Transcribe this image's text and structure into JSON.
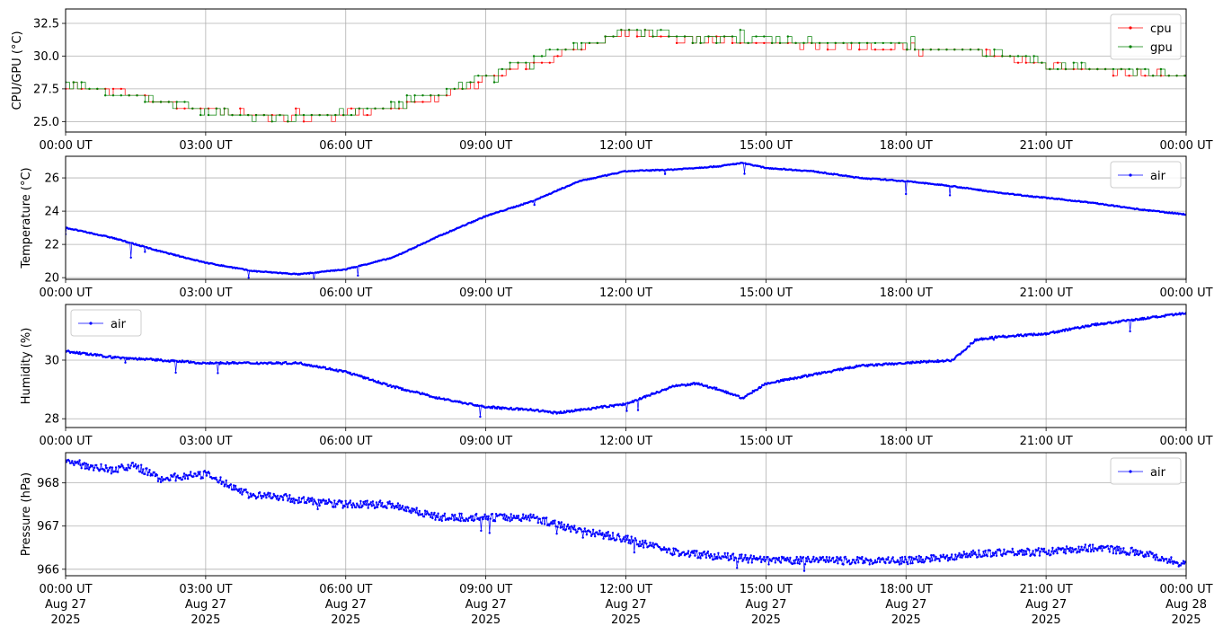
{
  "chart_data": [
    {
      "type": "line",
      "ylabel": "CPU/GPU (°C)",
      "ylim": [
        24.2,
        33.6
      ],
      "yticks": [
        25.0,
        27.5,
        30.0,
        32.5
      ],
      "ytick_labels": [
        "25.0",
        "27.5",
        "30.0",
        "32.5"
      ],
      "grid": true,
      "legend_position": "top-right",
      "x_ticks": [
        "00:00 UT",
        "03:00 UT",
        "06:00 UT",
        "09:00 UT",
        "12:00 UT",
        "15:00 UT",
        "18:00 UT",
        "21:00 UT",
        "00:00 UT"
      ],
      "series": [
        {
          "name": "cpu",
          "color": "#ff0000",
          "x_hours": [
            0,
            1,
            2,
            3,
            4,
            5,
            6,
            7,
            8,
            9,
            10,
            11,
            12,
            13,
            14,
            15,
            16,
            17,
            18,
            19,
            20,
            21,
            22,
            23,
            24
          ],
          "values": [
            27.8,
            27.3,
            26.5,
            25.8,
            25.5,
            25.3,
            25.6,
            26.0,
            27.0,
            28.3,
            29.5,
            30.6,
            31.8,
            31.3,
            31.2,
            31.0,
            30.9,
            30.7,
            30.6,
            30.3,
            30.0,
            29.3,
            29.0,
            28.6,
            28.5
          ]
        },
        {
          "name": "gpu",
          "color": "#008000",
          "x_hours": [
            0,
            1,
            2,
            3,
            4,
            5,
            6,
            7,
            8,
            9,
            10,
            11,
            12,
            13,
            14,
            15,
            16,
            17,
            18,
            19,
            20,
            21,
            22,
            23,
            24
          ],
          "values": [
            27.8,
            27.2,
            26.4,
            25.8,
            25.4,
            25.4,
            25.7,
            26.2,
            27.1,
            28.6,
            29.8,
            30.9,
            32.0,
            31.6,
            31.4,
            31.3,
            31.1,
            31.0,
            30.8,
            30.5,
            30.2,
            29.4,
            29.1,
            28.8,
            28.7
          ]
        }
      ]
    },
    {
      "type": "line",
      "ylabel": "Temperature (°C)",
      "ylim": [
        19.9,
        27.3
      ],
      "yticks": [
        20,
        22,
        24,
        26
      ],
      "ytick_labels": [
        "20",
        "22",
        "24",
        "26"
      ],
      "grid": true,
      "legend_position": "top-right",
      "x_ticks": [
        "00:00 UT",
        "03:00 UT",
        "06:00 UT",
        "09:00 UT",
        "12:00 UT",
        "15:00 UT",
        "18:00 UT",
        "21:00 UT",
        "00:00 UT"
      ],
      "series": [
        {
          "name": "air",
          "color": "#0000ff",
          "x_hours": [
            0,
            1,
            2,
            3,
            4,
            5,
            6,
            7,
            8,
            9,
            10,
            11,
            12,
            13,
            14,
            14.5,
            15,
            16,
            17,
            18,
            19,
            20,
            21,
            22,
            23,
            24
          ],
          "values": [
            23.0,
            22.4,
            21.6,
            20.9,
            20.4,
            20.2,
            20.5,
            21.2,
            22.5,
            23.7,
            24.6,
            25.8,
            26.4,
            26.5,
            26.7,
            26.9,
            26.6,
            26.4,
            26.0,
            25.8,
            25.5,
            25.1,
            24.8,
            24.5,
            24.1,
            23.8
          ]
        }
      ]
    },
    {
      "type": "line",
      "ylabel": "Humidity (%)",
      "ylim": [
        27.7,
        31.9
      ],
      "yticks": [
        28,
        30
      ],
      "ytick_labels": [
        "28",
        "30"
      ],
      "grid": true,
      "legend_position": "top-left",
      "x_ticks": [
        "00:00 UT",
        "03:00 UT",
        "06:00 UT",
        "09:00 UT",
        "12:00 UT",
        "15:00 UT",
        "18:00 UT",
        "21:00 UT",
        "00:00 UT"
      ],
      "series": [
        {
          "name": "air",
          "color": "#0000ff",
          "x_hours": [
            0,
            1,
            2,
            3,
            4,
            5,
            6,
            7,
            8,
            9,
            10,
            10.5,
            11,
            12,
            13,
            13.5,
            14,
            14.5,
            15,
            16,
            17,
            18,
            19,
            19.5,
            20,
            21,
            22,
            23,
            24
          ],
          "values": [
            30.3,
            30.1,
            30.0,
            29.9,
            29.9,
            29.9,
            29.6,
            29.1,
            28.7,
            28.4,
            28.3,
            28.2,
            28.3,
            28.5,
            29.1,
            29.2,
            29.0,
            28.7,
            29.2,
            29.5,
            29.8,
            29.9,
            30.0,
            30.7,
            30.8,
            30.9,
            31.2,
            31.4,
            31.6
          ]
        }
      ]
    },
    {
      "type": "scatter",
      "ylabel": "Pressure (hPa)",
      "ylim": [
        965.85,
        968.7
      ],
      "yticks": [
        966,
        967,
        968
      ],
      "ytick_labels": [
        "966",
        "967",
        "968"
      ],
      "grid": true,
      "legend_position": "top-right",
      "x_ticks": [
        "00:00 UT",
        "03:00 UT",
        "06:00 UT",
        "09:00 UT",
        "12:00 UT",
        "15:00 UT",
        "18:00 UT",
        "21:00 UT",
        "00:00 UT"
      ],
      "x_ticks_date": [
        "Aug 27",
        "Aug 27",
        "Aug 27",
        "Aug 27",
        "Aug 27",
        "Aug 27",
        "Aug 27",
        "Aug 27",
        "Aug 28"
      ],
      "x_ticks_year": [
        "2025",
        "2025",
        "2025",
        "2025",
        "2025",
        "2025",
        "2025",
        "2025",
        "2025"
      ],
      "series": [
        {
          "name": "air",
          "color": "#0000ff",
          "x_hours": [
            0,
            1,
            1.5,
            2,
            3,
            4,
            4.5,
            5,
            6,
            7,
            8,
            9,
            10,
            11,
            12,
            13,
            14,
            15,
            16,
            17,
            18,
            19,
            20,
            21,
            22,
            23,
            24
          ],
          "values": [
            968.5,
            968.3,
            968.4,
            968.1,
            968.2,
            967.7,
            967.7,
            967.6,
            967.5,
            967.5,
            967.2,
            967.2,
            967.2,
            966.9,
            966.7,
            966.4,
            966.3,
            966.2,
            966.2,
            966.2,
            966.2,
            966.3,
            966.4,
            966.4,
            966.5,
            966.4,
            966.1
          ]
        }
      ]
    }
  ]
}
